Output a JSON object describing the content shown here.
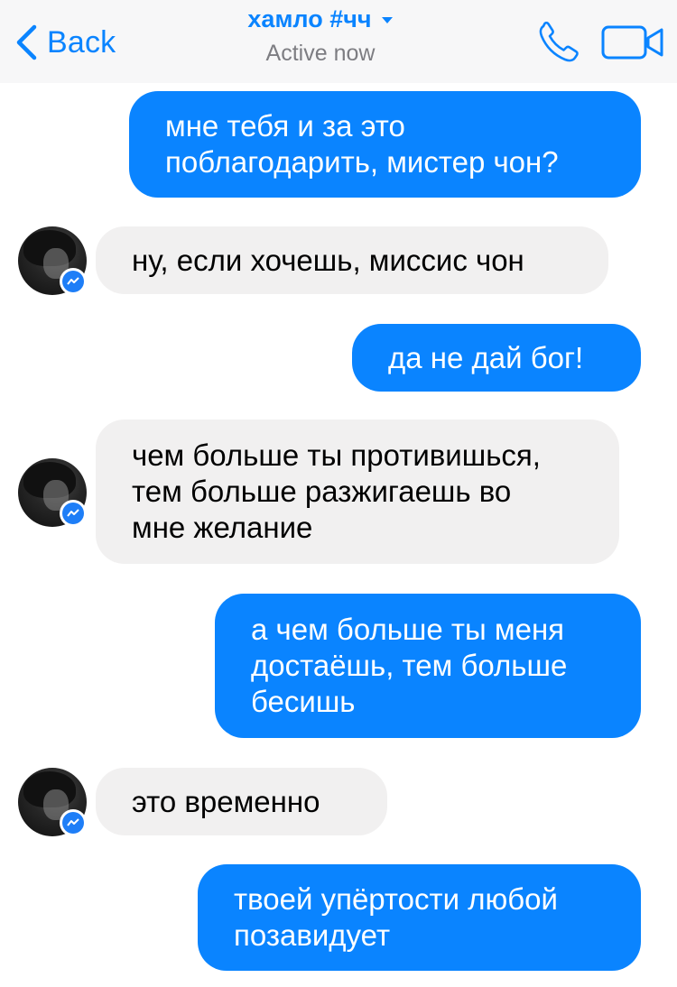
{
  "header": {
    "back_label": "Back",
    "title": "хамло #чч",
    "status": "Active now",
    "icons": [
      "chevron-left-icon",
      "caret-down-icon",
      "phone-icon",
      "video-camera-icon"
    ]
  },
  "colors": {
    "accent": "#0a84ff",
    "sent_bubble": "#0a84ff",
    "received_bubble": "#f1f0f0",
    "header_bg": "#f7f7f8"
  },
  "messages": [
    {
      "direction": "sent",
      "text": "мне тебя и за это\nпоблагодарить, мистер чон?"
    },
    {
      "direction": "received",
      "text": "ну, если хочешь, миссис чон"
    },
    {
      "direction": "sent",
      "text": "да не дай бог!"
    },
    {
      "direction": "received",
      "text": "чем больше ты противишься,\nтем больше разжигаешь во\nмне желание"
    },
    {
      "direction": "sent",
      "text": "а чем больше ты меня\nдостаёшь, тем больше\nбесишь"
    },
    {
      "direction": "received",
      "text": "это временно"
    },
    {
      "direction": "sent",
      "text": "твоей упёртости любой\nпозавидует"
    }
  ]
}
